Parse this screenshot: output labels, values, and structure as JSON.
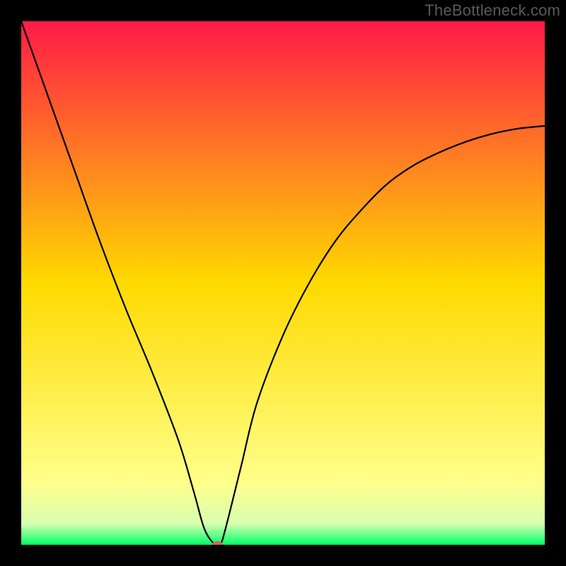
{
  "watermark": "TheBottleneck.com",
  "chart_data": {
    "type": "line",
    "title": "",
    "xlabel": "",
    "ylabel": "",
    "xlim": [
      0,
      100
    ],
    "ylim": [
      0,
      100
    ],
    "grid": false,
    "legend": false,
    "background_gradient_stops": [
      {
        "offset": 0.0,
        "color": "#ff1a47"
      },
      {
        "offset": 0.5,
        "color": "#ffda00"
      },
      {
        "offset": 0.88,
        "color": "#ffff8a"
      },
      {
        "offset": 0.96,
        "color": "#d8ffb0"
      },
      {
        "offset": 1.0,
        "color": "#00ff66"
      }
    ],
    "curve": {
      "name": "bottleneck-curve",
      "x": [
        0,
        5,
        10,
        15,
        20,
        25,
        30,
        33,
        35,
        37,
        38,
        39,
        42,
        45,
        50,
        55,
        60,
        65,
        70,
        75,
        80,
        85,
        90,
        95,
        100
      ],
      "y": [
        100,
        86,
        72,
        58,
        45,
        33,
        20,
        10,
        3,
        0,
        0,
        3,
        15,
        27,
        40,
        50,
        58,
        64,
        69,
        72.5,
        75,
        77,
        78.5,
        79.5,
        80
      ]
    },
    "marker": {
      "x": 37.5,
      "y": 0,
      "color": "#c96a5a",
      "rx": 8,
      "ry": 5
    },
    "dip_x": 37.5
  }
}
